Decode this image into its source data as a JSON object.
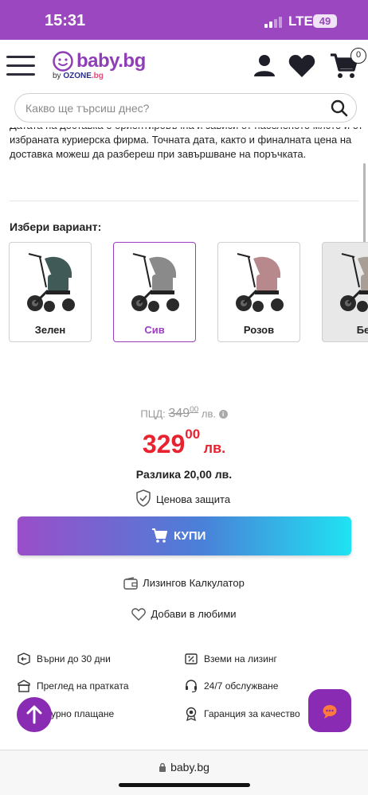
{
  "status_bar": {
    "time": "15:31",
    "network": "LTE",
    "battery": "49"
  },
  "header": {
    "logo_main": "baby.bg",
    "logo_by": "by",
    "logo_ozone": "OZONE",
    "logo_bg": ".bg",
    "cart_count": "0"
  },
  "search": {
    "placeholder": "Какво ще търсиш днес?"
  },
  "delivery_note": "Датата на доставка е ориентировъчна и зависи от населеното място и от избраната куриерска фирма. Точната дата, както и финалната цена на доставка можеш да разбереш при завършване на поръчката.",
  "variants": {
    "title": "Избери вариант:",
    "items": [
      {
        "label": "Зелен",
        "selected": false,
        "color": "#3f5a57"
      },
      {
        "label": "Сив",
        "selected": true,
        "color": "#8a8a8a"
      },
      {
        "label": "Розов",
        "selected": false,
        "color": "#b8898c"
      },
      {
        "label": "Бе",
        "selected": false,
        "color": "#a89e95"
      }
    ]
  },
  "pricing": {
    "rrp_label": "ПЦД:",
    "rrp_value": "349",
    "rrp_cents": "00",
    "rrp_currency": "лв.",
    "price_value": "329",
    "price_cents": "00",
    "price_currency": "лв.",
    "difference": "Разлика 20,00 лв.",
    "protection": "Ценова защита"
  },
  "buy_button": {
    "label": "КУПИ"
  },
  "links": {
    "leasing_calculator": "Лизингов Калкулатор",
    "add_to_favorites": "Добави в любими"
  },
  "features": [
    {
      "label": "Върни до 30 дни",
      "icon": "return-box-icon"
    },
    {
      "label": "Вземи на лизинг",
      "icon": "leasing-percent-icon"
    },
    {
      "label": "Преглед на пратката",
      "icon": "package-check-icon"
    },
    {
      "label": "24/7 обслужване",
      "icon": "headset-icon"
    },
    {
      "label": "урно плащане",
      "icon": "secure-payment-icon"
    },
    {
      "label": "Гаранция за качество",
      "icon": "quality-badge-icon"
    }
  ],
  "browser": {
    "url": "baby.bg"
  },
  "colors": {
    "brand_purple": "#9a47c0",
    "price_red": "#e8222e",
    "gradient_end": "#1fe3f2"
  }
}
